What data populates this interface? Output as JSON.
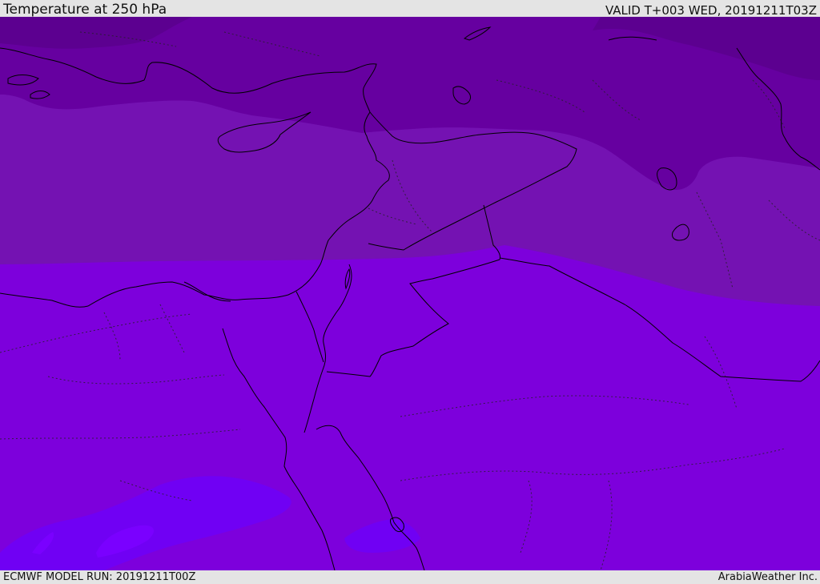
{
  "header": {
    "title": "Temperature at 250 hPa",
    "valid_time": "VALID T+003 WED, 20191211T03Z"
  },
  "footer": {
    "model_run": "ECMWF MODEL RUN: 20191211T00Z",
    "credit": "ArabiaWeather Inc."
  },
  "map": {
    "variable": "temperature",
    "level": "250 hPa",
    "fill_colors": {
      "darkest": "#5c0090",
      "dark": "#6600a0",
      "medium": "#7412b2",
      "light": "#7d00dc",
      "lightest": "#7000f4"
    },
    "coastline_color": "#000000",
    "borders_style": "dotted",
    "region": "Eastern Mediterranean / Middle East"
  }
}
